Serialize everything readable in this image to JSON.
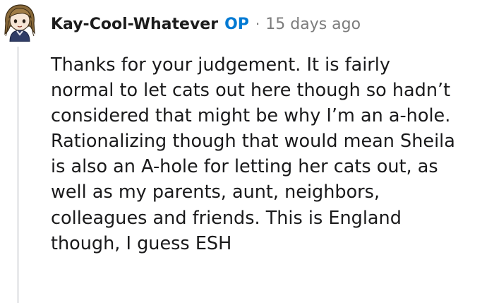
{
  "comment": {
    "author": "Kay-Cool-Whatever",
    "op_badge": "OP",
    "separator": "·",
    "timestamp": "15 days ago",
    "lines": [
      "Thanks for your judgement. It is fairly",
      "normal to let cats out here though so hadn’t",
      "considered that might be why I’m an a-hole.",
      "Rationalizing though that would mean Sheila",
      "is also an A-hole for letting her cats out, as",
      "well as my parents, aunt, neighbors,",
      "colleagues and friends. This is England",
      "though, I guess ESH"
    ]
  },
  "colors": {
    "op_blue": "#0079d3",
    "meta_gray": "#7c7c7c",
    "thread_line": "#e9eaeb"
  }
}
